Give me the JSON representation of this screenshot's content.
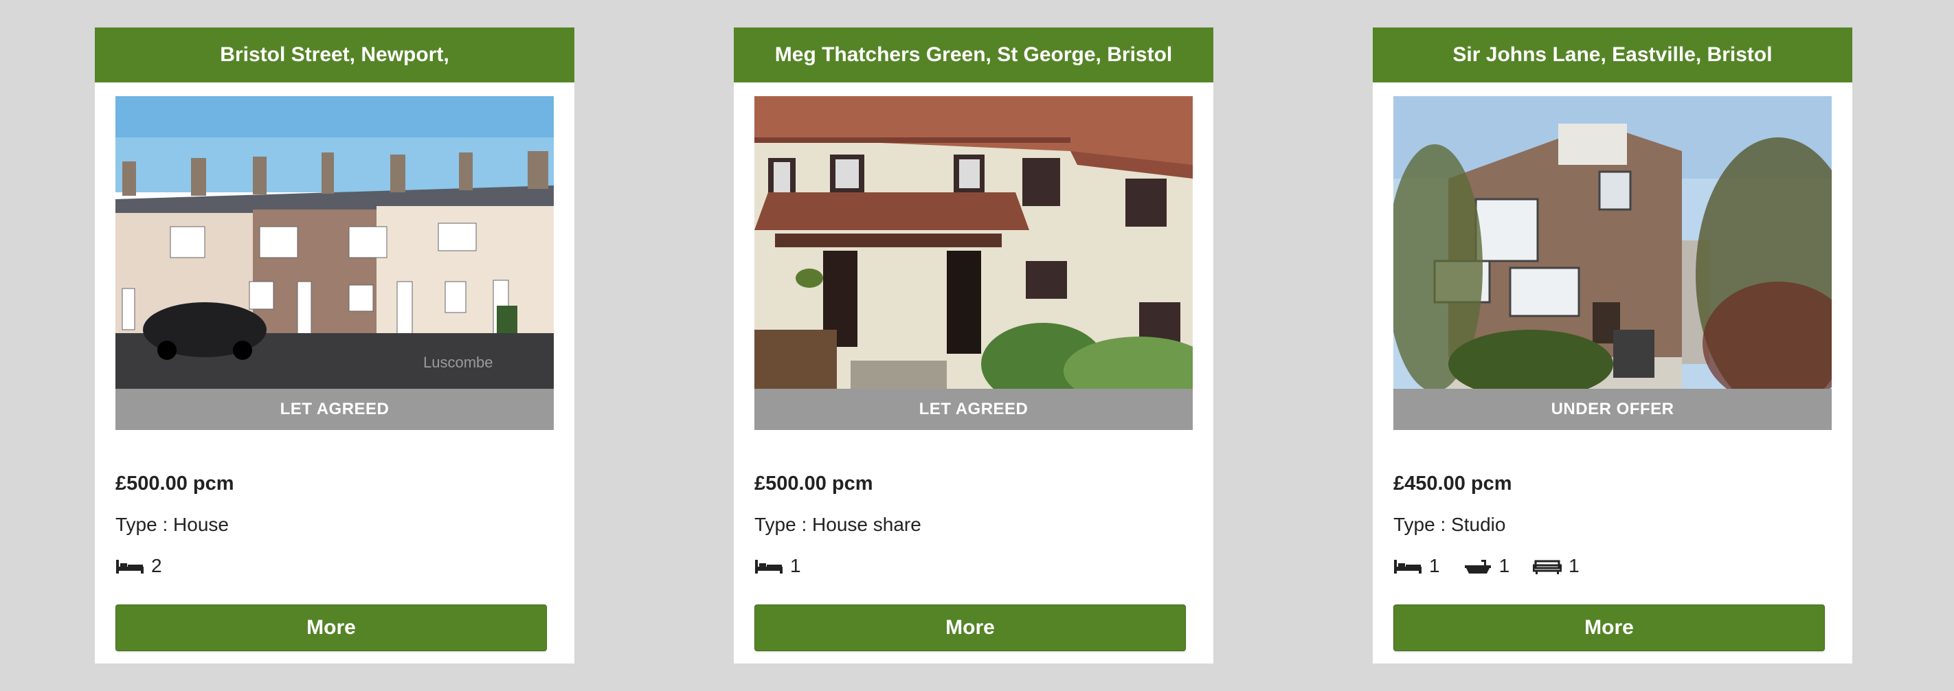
{
  "colors": {
    "header_green": "#558427",
    "status_grey": "#9a9a9a",
    "page_bg": "#d8d8d8"
  },
  "listings": [
    {
      "title": "Bristol Street, Newport,",
      "status": "LET AGREED",
      "price": "£500.00 pcm",
      "type": "Type : House",
      "bedrooms": "2",
      "more_label": "More",
      "photo_watermark": "Luscombe"
    },
    {
      "title": "Meg Thatchers Green, St George, Bristol",
      "status": "LET AGREED",
      "price": "£500.00 pcm",
      "type": "Type : House share",
      "bedrooms": "1",
      "more_label": "More"
    },
    {
      "title": "Sir Johns Lane, Eastville, Bristol",
      "status": "UNDER OFFER",
      "price": "£450.00 pcm",
      "type": "Type : Studio",
      "bedrooms": "1",
      "bathrooms": "1",
      "receptions": "1",
      "more_label": "More"
    }
  ]
}
